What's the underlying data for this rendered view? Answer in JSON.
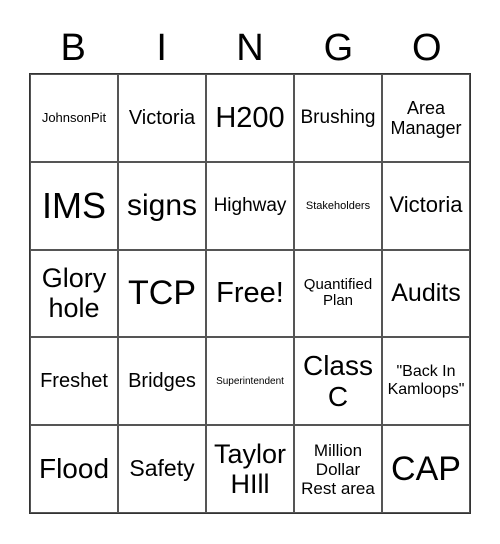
{
  "header": [
    "B",
    "I",
    "N",
    "G",
    "O"
  ],
  "cells": [
    "JohnsonPit",
    "Victoria",
    "H200",
    "Brushing",
    "Area Manager",
    "IMS",
    "signs",
    "Highway",
    "Stakeholders",
    "Victoria",
    "Glory hole",
    "TCP",
    "Free!",
    "Quantified Plan",
    "Audits",
    "Freshet",
    "Bridges",
    "Superintendent",
    "Class C",
    "\"Back In Kamloops\"",
    "Flood",
    "Safety",
    "Taylor HIll",
    "Million Dollar Rest area",
    "CAP"
  ]
}
